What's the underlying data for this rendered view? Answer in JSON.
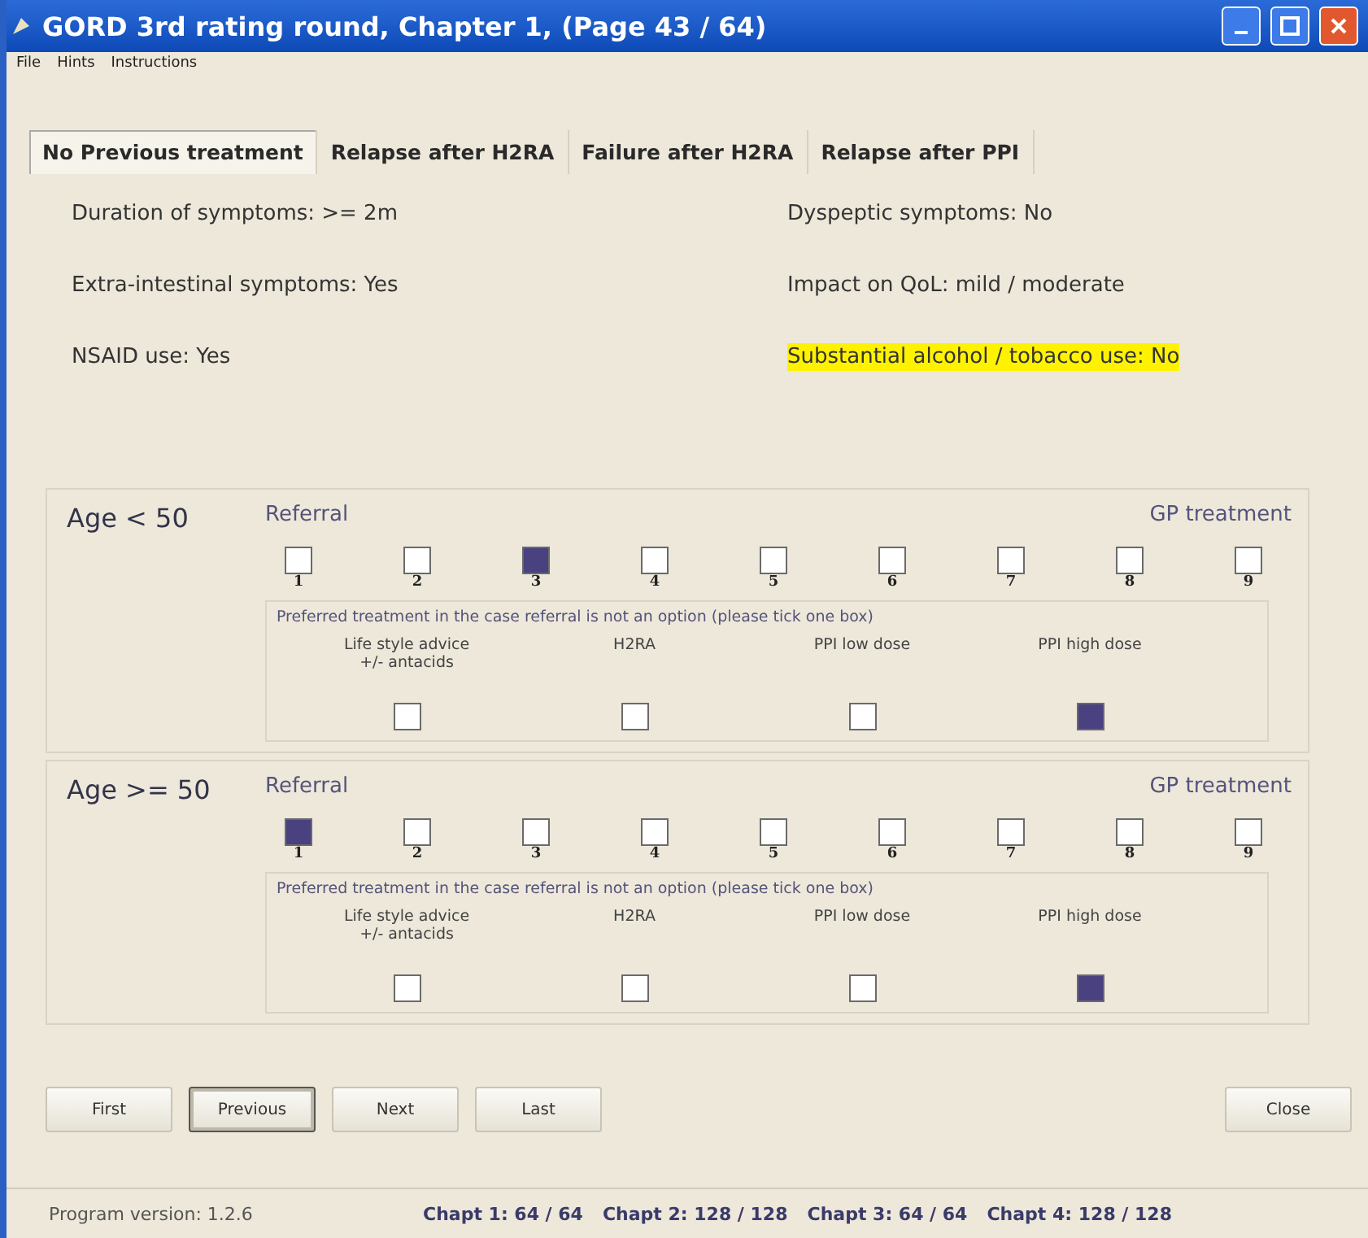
{
  "window": {
    "title": "GORD 3rd rating round, Chapter 1,  (Page 43 / 64)"
  },
  "menu": [
    "File",
    "Hints",
    "Instructions"
  ],
  "tabs": [
    {
      "label": "No Previous treatment",
      "selected": true
    },
    {
      "label": "Relapse after H2RA",
      "selected": false
    },
    {
      "label": "Failure after H2RA",
      "selected": false
    },
    {
      "label": "Relapse after PPI",
      "selected": false
    }
  ],
  "criteria": [
    {
      "text": "Duration of symptoms: >= 2m",
      "highlighted": false
    },
    {
      "text": "Dyspeptic symptoms: No",
      "highlighted": false
    },
    {
      "text": "Extra-intestinal symptoms: Yes",
      "highlighted": false
    },
    {
      "text": "Impact on QoL: mild / moderate",
      "highlighted": false
    },
    {
      "text": "NSAID use: Yes",
      "highlighted": false
    },
    {
      "text": "Substantial alcohol / tobacco use: No",
      "highlighted": true
    }
  ],
  "groups": [
    {
      "age": "Age < 50",
      "scale_left": "Referral",
      "scale_right": "GP treatment",
      "scale": [
        {
          "label": "1",
          "checked": false
        },
        {
          "label": "2",
          "checked": false
        },
        {
          "label": "3",
          "checked": true
        },
        {
          "label": "4",
          "checked": false
        },
        {
          "label": "5",
          "checked": false
        },
        {
          "label": "6",
          "checked": false
        },
        {
          "label": "7",
          "checked": false
        },
        {
          "label": "8",
          "checked": false
        },
        {
          "label": "9",
          "checked": false
        }
      ],
      "preferred": {
        "prompt": "Preferred treatment in the case referral is not an option (please tick one box)",
        "options": [
          {
            "label": "Life style advice\n+/- antacids",
            "checked": false
          },
          {
            "label": "H2RA",
            "checked": false
          },
          {
            "label": "PPI low dose",
            "checked": false
          },
          {
            "label": "PPI high dose",
            "checked": true
          }
        ]
      }
    },
    {
      "age": "Age >= 50",
      "scale_left": "Referral",
      "scale_right": "GP treatment",
      "scale": [
        {
          "label": "1",
          "checked": true
        },
        {
          "label": "2",
          "checked": false
        },
        {
          "label": "3",
          "checked": false
        },
        {
          "label": "4",
          "checked": false
        },
        {
          "label": "5",
          "checked": false
        },
        {
          "label": "6",
          "checked": false
        },
        {
          "label": "7",
          "checked": false
        },
        {
          "label": "8",
          "checked": false
        },
        {
          "label": "9",
          "checked": false
        }
      ],
      "preferred": {
        "prompt": "Preferred treatment in the case referral is not an option (please tick one box)",
        "options": [
          {
            "label": "Life style advice\n+/- antacids",
            "checked": false
          },
          {
            "label": "H2RA",
            "checked": false
          },
          {
            "label": "PPI low dose",
            "checked": false
          },
          {
            "label": "PPI high dose",
            "checked": true
          }
        ]
      }
    }
  ],
  "nav_buttons": [
    {
      "label": "First",
      "focused": false
    },
    {
      "label": "Previous",
      "focused": true
    },
    {
      "label": "Next",
      "focused": false
    },
    {
      "label": "Last",
      "focused": false
    }
  ],
  "close_button": {
    "label": "Close"
  },
  "status_bar": {
    "version": "Program version: 1.2.6",
    "chapters": [
      {
        "text": "Chapt 1: 64 / 64",
        "complete": true
      },
      {
        "text": "Chapt 2: 128 / 128",
        "complete": true
      },
      {
        "text": "Chapt 3: 64 / 64",
        "complete": true
      },
      {
        "text": "Chapt 4: 128 / 128",
        "complete": true
      }
    ]
  }
}
